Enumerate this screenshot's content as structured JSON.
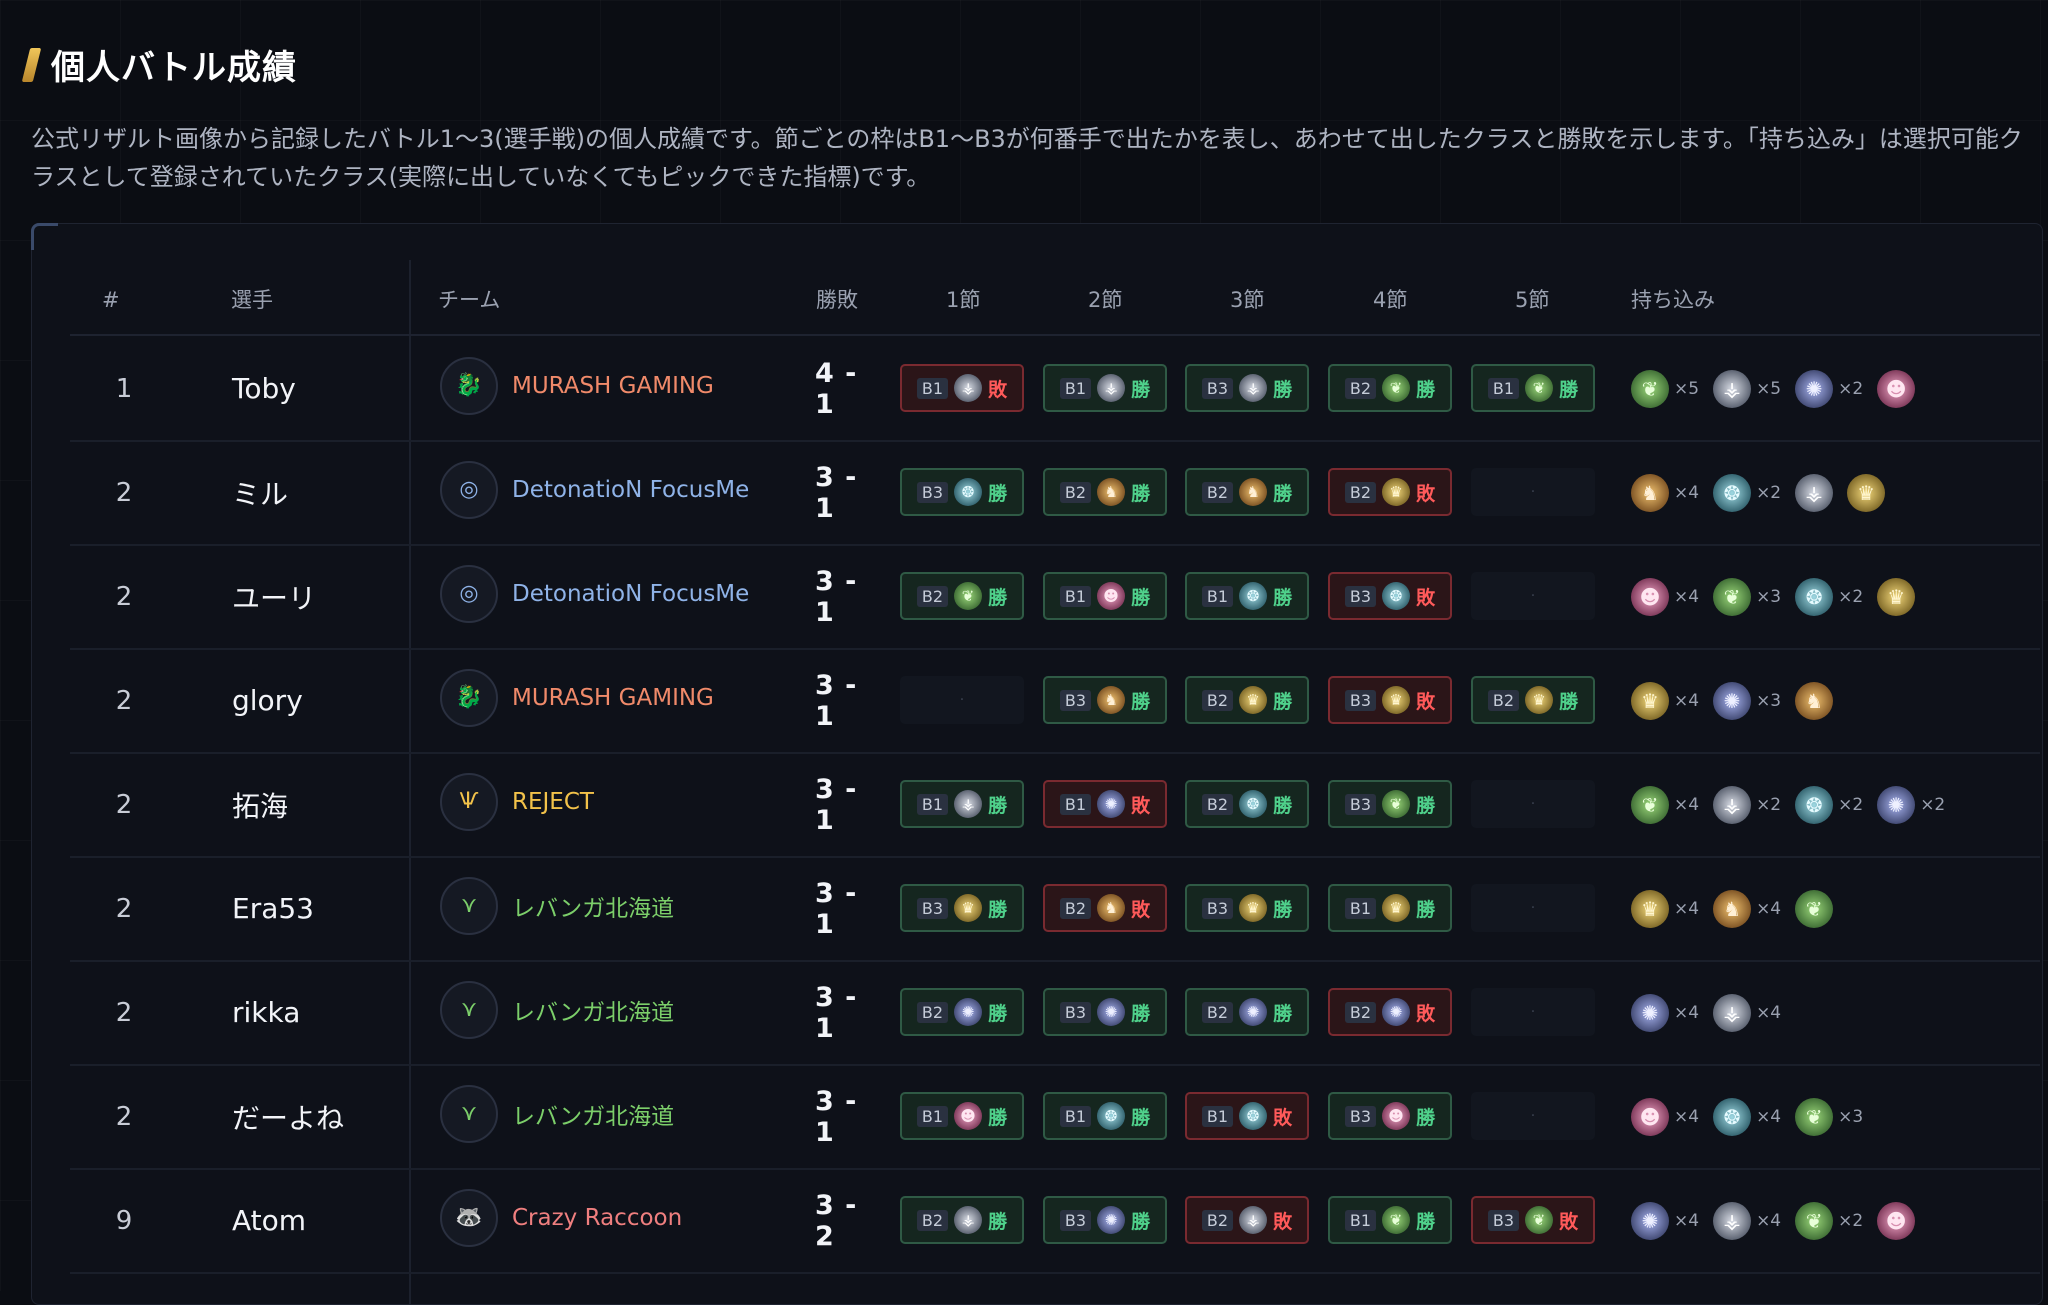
{
  "section": {
    "title": "個人バトル成績",
    "description": "公式リザルト画像から記録したバトル1〜3(選手戦)の個人成績です。節ごとの枠はB1〜B3が何番手で出たかを表し、あわせて出したクラスと勝敗を示します。「持ち込み」は選択可能クラスとして登録されていたクラス(実際に出していなくてもピックできた指標)です。"
  },
  "table": {
    "headers": {
      "rank": "#",
      "player": "選手",
      "team": "チーム",
      "record": "勝敗",
      "s1": "1節",
      "s2": "2節",
      "s3": "3節",
      "s4": "4節",
      "s5": "5節",
      "picks": "持ち込み"
    },
    "rows": [
      {
        "rank": "1",
        "player": "Toby",
        "team": "MURASH GAMING",
        "team_color": "#f08a6a",
        "team_icon": "fire-dragon-icon",
        "team_glyph": "🐉",
        "record": "4 - 1",
        "sets": [
          {
            "b": "B1",
            "cls": "bishop",
            "res": "敗",
            "state": "lose"
          },
          {
            "b": "B1",
            "cls": "bishop",
            "res": "勝",
            "state": "win"
          },
          {
            "b": "B3",
            "cls": "bishop",
            "res": "勝",
            "state": "win"
          },
          {
            "b": "B2",
            "cls": "elf",
            "res": "勝",
            "state": "win"
          },
          {
            "b": "B1",
            "cls": "elf",
            "res": "勝",
            "state": "win"
          }
        ],
        "picks": [
          {
            "cls": "elf",
            "count": "×5"
          },
          {
            "cls": "bishop",
            "count": "×5"
          },
          {
            "cls": "witch",
            "count": "×2"
          },
          {
            "cls": "nightmare",
            "count": ""
          }
        ]
      },
      {
        "rank": "2",
        "player": "ミル",
        "team": "DetonatioN FocusMe",
        "team_color": "#8fb3e8",
        "team_icon": "dfm-logo-icon",
        "team_glyph": "◎",
        "record": "3 - 1",
        "sets": [
          {
            "b": "B3",
            "cls": "nemesis",
            "res": "勝",
            "state": "win"
          },
          {
            "b": "B2",
            "cls": "dragon",
            "res": "勝",
            "state": "win"
          },
          {
            "b": "B2",
            "cls": "dragon",
            "res": "勝",
            "state": "win"
          },
          {
            "b": "B2",
            "cls": "royal",
            "res": "敗",
            "state": "lose"
          },
          {
            "b": "",
            "cls": "",
            "res": "",
            "state": "empty"
          }
        ],
        "picks": [
          {
            "cls": "dragon",
            "count": "×4"
          },
          {
            "cls": "nemesis",
            "count": "×2"
          },
          {
            "cls": "bishop",
            "count": ""
          },
          {
            "cls": "royal",
            "count": ""
          }
        ]
      },
      {
        "rank": "2",
        "player": "ユーリ",
        "team": "DetonatioN FocusMe",
        "team_color": "#8fb3e8",
        "team_icon": "dfm-logo-icon",
        "team_glyph": "◎",
        "record": "3 - 1",
        "sets": [
          {
            "b": "B2",
            "cls": "elf",
            "res": "勝",
            "state": "win"
          },
          {
            "b": "B1",
            "cls": "nightmare",
            "res": "勝",
            "state": "win"
          },
          {
            "b": "B1",
            "cls": "nemesis",
            "res": "勝",
            "state": "win"
          },
          {
            "b": "B3",
            "cls": "nemesis",
            "res": "敗",
            "state": "lose"
          },
          {
            "b": "",
            "cls": "",
            "res": "",
            "state": "empty"
          }
        ],
        "picks": [
          {
            "cls": "nightmare",
            "count": "×4"
          },
          {
            "cls": "elf",
            "count": "×3"
          },
          {
            "cls": "nemesis",
            "count": "×2"
          },
          {
            "cls": "royal",
            "count": ""
          }
        ]
      },
      {
        "rank": "2",
        "player": "glory",
        "team": "MURASH GAMING",
        "team_color": "#f08a6a",
        "team_icon": "fire-dragon-icon",
        "team_glyph": "🐉",
        "record": "3 - 1",
        "sets": [
          {
            "b": "",
            "cls": "",
            "res": "",
            "state": "empty"
          },
          {
            "b": "B3",
            "cls": "dragon",
            "res": "勝",
            "state": "win"
          },
          {
            "b": "B2",
            "cls": "royal",
            "res": "勝",
            "state": "win"
          },
          {
            "b": "B3",
            "cls": "royal",
            "res": "敗",
            "state": "lose"
          },
          {
            "b": "B2",
            "cls": "royal",
            "res": "勝",
            "state": "win"
          }
        ],
        "picks": [
          {
            "cls": "royal",
            "count": "×4"
          },
          {
            "cls": "witch",
            "count": "×3"
          },
          {
            "cls": "dragon",
            "count": ""
          }
        ]
      },
      {
        "rank": "2",
        "player": "拓海",
        "team": "REJECT",
        "team_color": "#f2c24a",
        "team_icon": "reject-logo-icon",
        "team_glyph": "Ѱ",
        "record": "3 - 1",
        "sets": [
          {
            "b": "B1",
            "cls": "bishop",
            "res": "勝",
            "state": "win"
          },
          {
            "b": "B1",
            "cls": "witch",
            "res": "敗",
            "state": "lose"
          },
          {
            "b": "B2",
            "cls": "nemesis",
            "res": "勝",
            "state": "win"
          },
          {
            "b": "B3",
            "cls": "elf",
            "res": "勝",
            "state": "win"
          },
          {
            "b": "",
            "cls": "",
            "res": "",
            "state": "empty"
          }
        ],
        "picks": [
          {
            "cls": "elf",
            "count": "×4"
          },
          {
            "cls": "bishop",
            "count": "×2"
          },
          {
            "cls": "nemesis",
            "count": "×2"
          },
          {
            "cls": "witch",
            "count": "×2"
          }
        ]
      },
      {
        "rank": "2",
        "player": "Era53",
        "team": "レバンガ北海道",
        "team_color": "#7ccf6a",
        "team_icon": "levanga-logo-icon",
        "team_glyph": "⋎",
        "record": "3 - 1",
        "sets": [
          {
            "b": "B3",
            "cls": "royal",
            "res": "勝",
            "state": "win"
          },
          {
            "b": "B2",
            "cls": "dragon",
            "res": "敗",
            "state": "lose"
          },
          {
            "b": "B3",
            "cls": "royal",
            "res": "勝",
            "state": "win"
          },
          {
            "b": "B1",
            "cls": "royal",
            "res": "勝",
            "state": "win"
          },
          {
            "b": "",
            "cls": "",
            "res": "",
            "state": "empty"
          }
        ],
        "picks": [
          {
            "cls": "royal",
            "count": "×4"
          },
          {
            "cls": "dragon",
            "count": "×4"
          },
          {
            "cls": "elf",
            "count": ""
          }
        ]
      },
      {
        "rank": "2",
        "player": "rikka",
        "team": "レバンガ北海道",
        "team_color": "#7ccf6a",
        "team_icon": "levanga-logo-icon",
        "team_glyph": "⋎",
        "record": "3 - 1",
        "sets": [
          {
            "b": "B2",
            "cls": "witch",
            "res": "勝",
            "state": "win"
          },
          {
            "b": "B3",
            "cls": "witch",
            "res": "勝",
            "state": "win"
          },
          {
            "b": "B2",
            "cls": "witch",
            "res": "勝",
            "state": "win"
          },
          {
            "b": "B2",
            "cls": "witch",
            "res": "敗",
            "state": "lose"
          },
          {
            "b": "",
            "cls": "",
            "res": "",
            "state": "empty"
          }
        ],
        "picks": [
          {
            "cls": "witch",
            "count": "×4"
          },
          {
            "cls": "bishop",
            "count": "×4"
          }
        ]
      },
      {
        "rank": "2",
        "player": "だーよね",
        "team": "レバンガ北海道",
        "team_color": "#7ccf6a",
        "team_icon": "levanga-logo-icon",
        "team_glyph": "⋎",
        "record": "3 - 1",
        "sets": [
          {
            "b": "B1",
            "cls": "nightmare",
            "res": "勝",
            "state": "win"
          },
          {
            "b": "B1",
            "cls": "nemesis",
            "res": "勝",
            "state": "win"
          },
          {
            "b": "B1",
            "cls": "nemesis",
            "res": "敗",
            "state": "lose"
          },
          {
            "b": "B3",
            "cls": "nightmare",
            "res": "勝",
            "state": "win"
          },
          {
            "b": "",
            "cls": "",
            "res": "",
            "state": "empty"
          }
        ],
        "picks": [
          {
            "cls": "nightmare",
            "count": "×4"
          },
          {
            "cls": "nemesis",
            "count": "×4"
          },
          {
            "cls": "elf",
            "count": "×3"
          }
        ]
      },
      {
        "rank": "9",
        "player": "Atom",
        "team": "Crazy Raccoon",
        "team_color": "#ef7f7f",
        "team_icon": "raccoon-logo-icon",
        "team_glyph": "🦝",
        "record": "3 - 2",
        "sets": [
          {
            "b": "B2",
            "cls": "bishop",
            "res": "勝",
            "state": "win"
          },
          {
            "b": "B3",
            "cls": "witch",
            "res": "勝",
            "state": "win"
          },
          {
            "b": "B2",
            "cls": "bishop",
            "res": "敗",
            "state": "lose"
          },
          {
            "b": "B1",
            "cls": "elf",
            "res": "勝",
            "state": "win"
          },
          {
            "b": "B3",
            "cls": "elf",
            "res": "敗",
            "state": "lose"
          }
        ],
        "picks": [
          {
            "cls": "witch",
            "count": "×4"
          },
          {
            "cls": "bishop",
            "count": "×4"
          },
          {
            "cls": "elf",
            "count": "×2"
          },
          {
            "cls": "nightmare",
            "count": ""
          }
        ]
      }
    ]
  },
  "class_icons": {
    "elf": {
      "glyph": "❦",
      "name": "leaf-class-icon"
    },
    "royal": {
      "glyph": "♛",
      "name": "crown-class-icon"
    },
    "witch": {
      "glyph": "✺",
      "name": "gear-class-icon"
    },
    "dragon": {
      "glyph": "♞",
      "name": "dragon-class-icon"
    },
    "nightmare": {
      "glyph": "☻",
      "name": "nightmare-class-icon"
    },
    "bishop": {
      "glyph": "⚶",
      "name": "wings-class-icon"
    },
    "nemesis": {
      "glyph": "❂",
      "name": "nemesis-class-icon"
    }
  }
}
